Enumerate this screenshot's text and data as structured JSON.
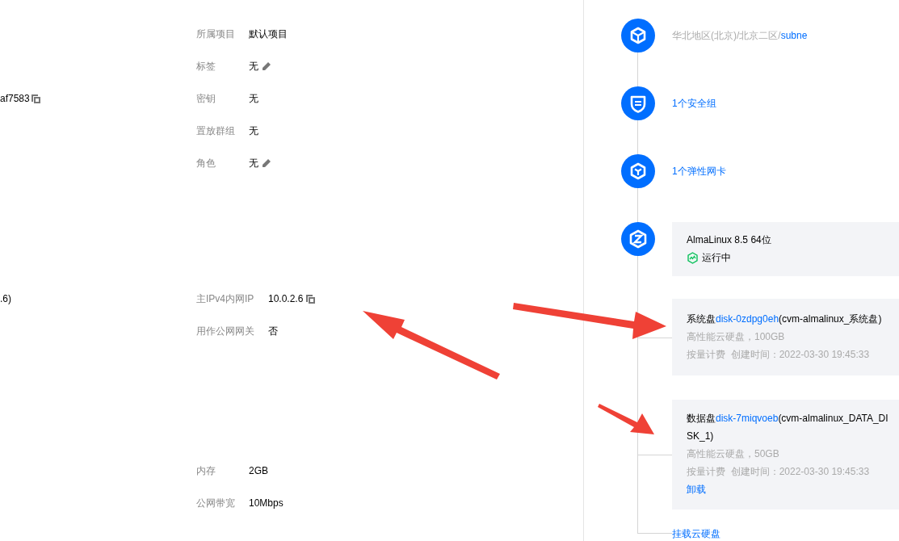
{
  "detail_groups": [
    {
      "rows": [
        {
          "label": "所属项目",
          "value": "默认项目",
          "kind": "plain"
        },
        {
          "label": "标签",
          "value": "无",
          "kind": "editable"
        },
        {
          "label": "密钥",
          "value": "无",
          "kind": "plain",
          "column_1": {
            "text": "af7583",
            "kind": "copyable"
          }
        },
        {
          "label": "置放群组",
          "value": "无",
          "kind": "plain"
        },
        {
          "label": "角色",
          "value": "无",
          "kind": "editable"
        }
      ]
    },
    {
      "rows": [
        {
          "label": "主IPv4内网IP",
          "value": "10.0.2.6",
          "kind": "copyable",
          "column_1": {
            "text": ".6)",
            "kind": "plain"
          }
        },
        {
          "label": "用作公网网关",
          "value": "否",
          "kind": "plain"
        }
      ]
    },
    {
      "rows": [
        {
          "label": "内存",
          "value": "2GB",
          "kind": "plain"
        },
        {
          "label": "公网带宽",
          "value": "10Mbps",
          "kind": "plain"
        }
      ]
    }
  ],
  "topology": {
    "nodes": [
      {
        "kind": "subnet",
        "location": "华北地区(北京)/北京二区/",
        "link": "subne"
      },
      {
        "kind": "security_group",
        "link": "1个安全组"
      },
      {
        "kind": "network_card",
        "link": "1个弹性网卡"
      },
      {
        "kind": "os",
        "os": "AlmaLinux 8.5 64位",
        "status": "运行中"
      }
    ],
    "disks": [
      {
        "type": "系统盘",
        "id": "disk-0zdpg0eh",
        "name": "(cvm-almalinux_系统盘)",
        "spec": "高性能云硬盘，100GB",
        "billing": "按量计费",
        "created": "创建时间：2022-03-30 19:45:33"
      },
      {
        "type": "数据盘",
        "id": "disk-7miqvoeb",
        "name": "(cvm-almalinux_DATA_DISK_1)",
        "spec": "高性能云硬盘，50GB",
        "billing": "按量计费",
        "created": "创建时间：2022-03-30 19:45:33",
        "action": "卸载"
      }
    ],
    "mount_link": "挂载云硬盘"
  }
}
